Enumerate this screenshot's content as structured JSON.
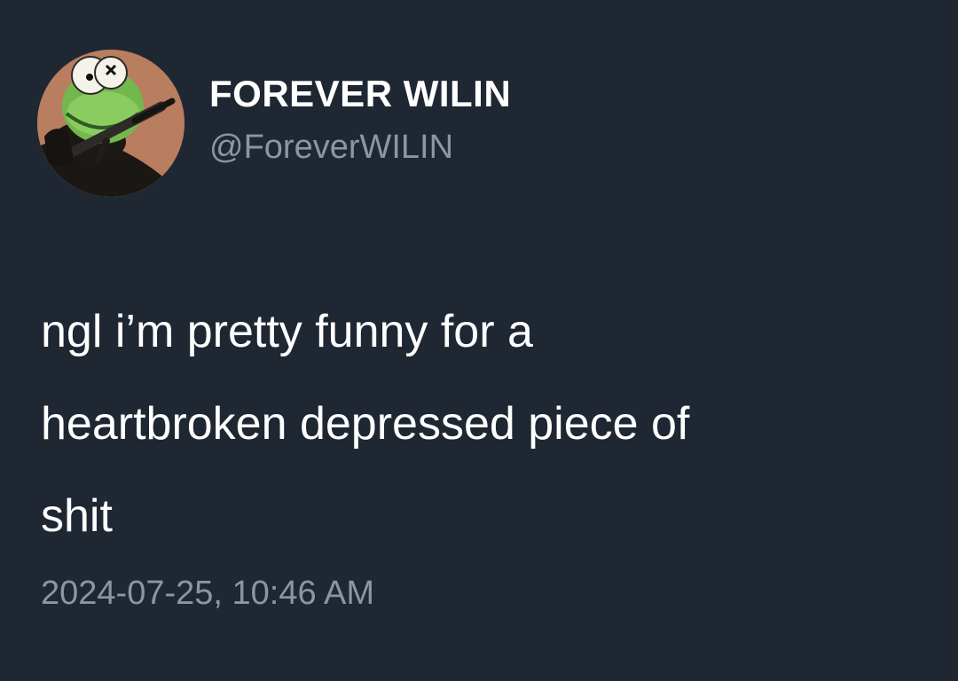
{
  "tweet": {
    "avatar_icon": "frog-avatar-icon",
    "display_name": "FOREVER WILIN",
    "handle": "@ForeverWILIN",
    "text": "ngl i’m pretty funny for a\nheartbroken depressed piece of\nshit",
    "timestamp": "2024-07-25, 10:46 AM"
  },
  "colors": {
    "background": "#1f2733",
    "primary_text": "#ffffff",
    "secondary_text": "#8c96a3"
  }
}
